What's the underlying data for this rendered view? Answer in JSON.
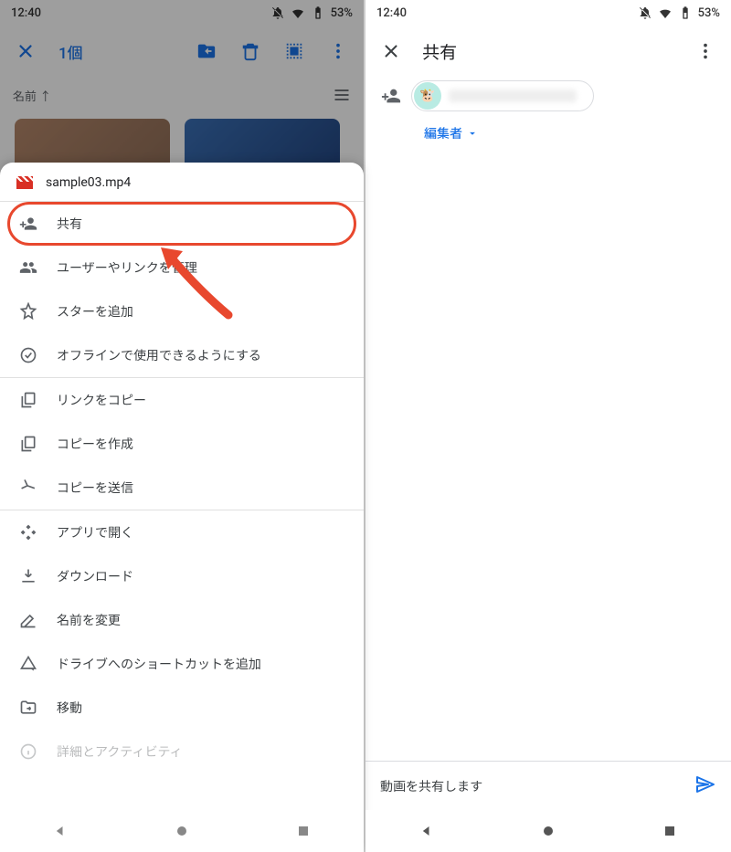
{
  "status": {
    "time": "12:40",
    "battery": "53%"
  },
  "left": {
    "selection_count": "1個",
    "sort_label": "名前",
    "file_name": "sample03.mp4",
    "menu": {
      "share": "共有",
      "manage": "ユーザーやリンクを管理",
      "star": "スターを追加",
      "offline": "オフラインで使用できるようにする",
      "copylink": "リンクをコピー",
      "makecopy": "コピーを作成",
      "sendcopy": "コピーを送信",
      "openwith": "アプリで開く",
      "download": "ダウンロード",
      "rename": "名前を変更",
      "shortcut": "ドライブへのショートカットを追加",
      "move": "移動",
      "details": "詳細とアクティビティ"
    }
  },
  "right": {
    "title": "共有",
    "role_label": "編集者",
    "footer_msg": "動画を共有します"
  }
}
